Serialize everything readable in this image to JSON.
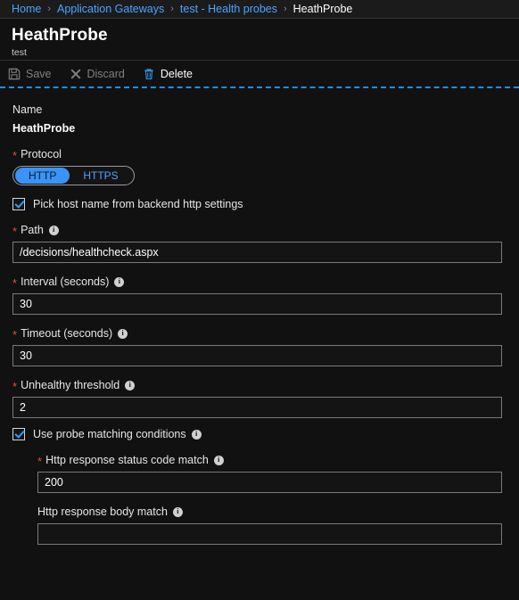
{
  "breadcrumb": {
    "separator": "›",
    "items": [
      {
        "label": "Home",
        "current": false
      },
      {
        "label": "Application Gateways",
        "current": false
      },
      {
        "label": "test - Health probes",
        "current": false
      },
      {
        "label": "HeathProbe",
        "current": true
      }
    ]
  },
  "header": {
    "title": "HeathProbe",
    "subtitle": "test"
  },
  "toolbar": {
    "save_label": "Save",
    "discard_label": "Discard",
    "delete_label": "Delete"
  },
  "form": {
    "name": {
      "label": "Name",
      "value": "HeathProbe"
    },
    "protocol": {
      "label": "Protocol",
      "options": [
        "HTTP",
        "HTTPS"
      ],
      "selected": "HTTP"
    },
    "pick_host_name": {
      "label": "Pick host name from backend http settings",
      "checked": true
    },
    "path": {
      "label": "Path",
      "value": "/decisions/healthcheck.aspx"
    },
    "interval": {
      "label": "Interval (seconds)",
      "value": "30"
    },
    "timeout": {
      "label": "Timeout (seconds)",
      "value": "30"
    },
    "unhealthy_threshold": {
      "label": "Unhealthy threshold",
      "value": "2"
    },
    "use_probe_matching": {
      "label": "Use probe matching conditions",
      "checked": true
    },
    "status_code_match": {
      "label": "Http response status code match",
      "value": "200"
    },
    "body_match": {
      "label": "Http response body match",
      "value": ""
    }
  },
  "colors": {
    "background": "#111111",
    "accent_blue": "#3b93f7",
    "link_blue": "#4da3ff",
    "required_red": "#e74c3c",
    "divider_blue": "#1f8fe0"
  }
}
